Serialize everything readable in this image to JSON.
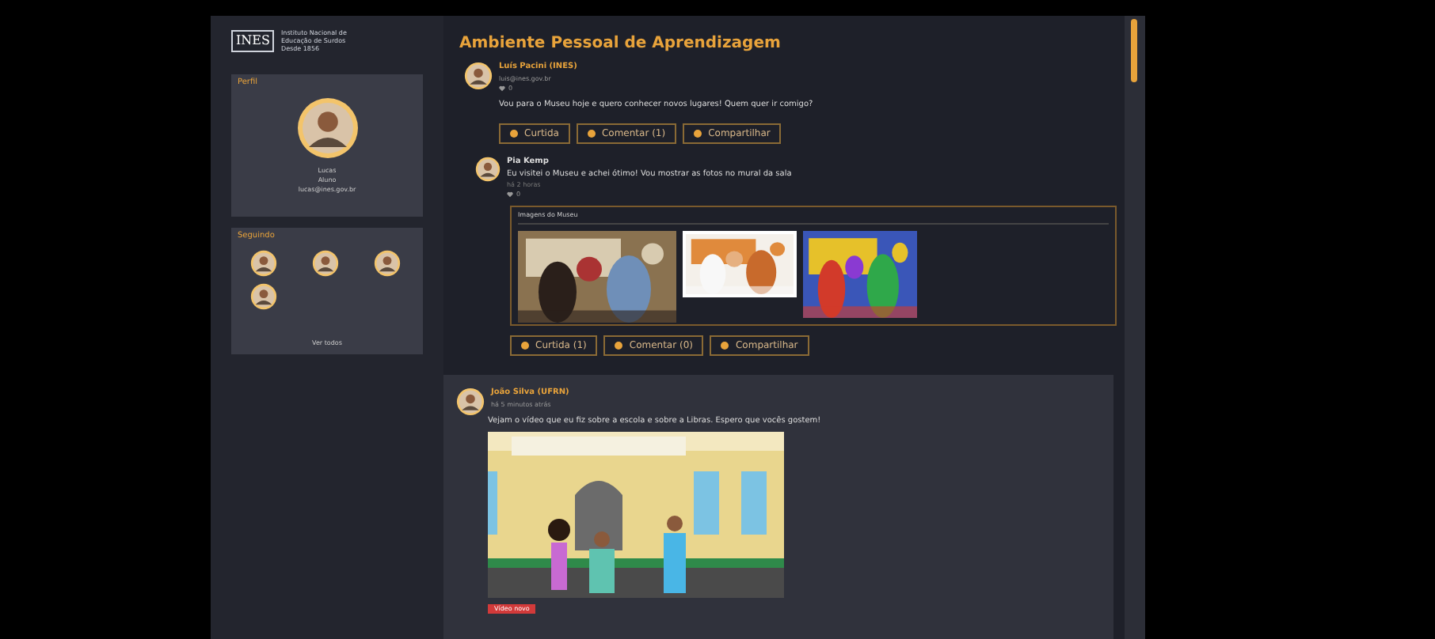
{
  "logo": {
    "mark": "INES",
    "lines": [
      "Instituto Nacional de",
      "Educação de Surdos",
      "Desde 1856"
    ]
  },
  "profile": {
    "heading": "Perfil",
    "name": "Lucas",
    "role": "Aluno",
    "email": "lucas@ines.gov.br"
  },
  "following": {
    "heading": "Seguindo",
    "people": [
      {
        "kind": "avatar"
      },
      {
        "kind": "avatar"
      },
      {
        "kind": "avatar"
      },
      {
        "kind": "avatar"
      }
    ],
    "more": "Ver todos"
  },
  "page_title": "Ambiente Pessoal de Aprendizagem",
  "posts": [
    {
      "author": "Luís Pacini (INES)",
      "email": "luis@ines.gov.br",
      "likes": "0",
      "text": "Vou para o Museu hoje e quero conhecer novos lugares! Quem quer ir comigo?",
      "actions": [
        "Curtida",
        "Comentar (1)",
        "Compartilhar"
      ],
      "reply": {
        "author": "Pia Kemp",
        "text": "Eu visitei o Museu e achei ótimo! Vou mostrar as fotos no mural da sala",
        "date": "há 2 horas",
        "likes": "0",
        "gallery_title": "Imagens do Museu",
        "gallery": [
          {
            "kind": "picture"
          },
          {
            "kind": "picture"
          },
          {
            "kind": "picture"
          }
        ],
        "actions": [
          "Curtida (1)",
          "Comentar (0)",
          "Compartilhar"
        ]
      }
    },
    {
      "author": "João Silva (UFRN)",
      "date": "há 5 minutos atrás",
      "text": "Vejam o vídeo que eu fiz sobre a escola e sobre a Libras. Espero que vocês gostem!",
      "media": {
        "kind": "picture"
      },
      "tag": "Vídeo novo"
    }
  ]
}
